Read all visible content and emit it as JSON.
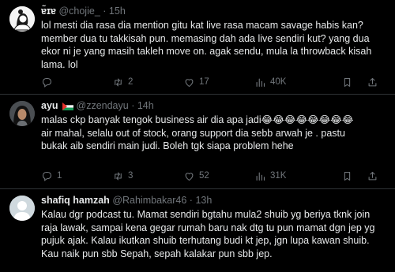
{
  "tweets": [
    {
      "name": "ɐ̃ɪɐ",
      "handle": "@chojie_",
      "dot": "·",
      "time": "15h",
      "text": "lol mesti dia rasa dia mention gitu kat live rasa macam savage habis kan?\nmember dua tu takkisah pun. memasing dah ada live sendiri kut? yang dua\nekor ni je yang masih takleh move on. agak sendu, mula la throwback kisah\nlama. lol",
      "replies": "",
      "reposts": "2",
      "likes": "17",
      "views": "40K"
    },
    {
      "name": "ayu",
      "handle": "@zzendayu",
      "dot": "·",
      "time": "14h",
      "text": "malas ckp banyak tengok business air dia apa jadi😂😂😂😂😂😂😂😂\nair mahal, selalu out of stock, orang support dia sebb arwah je . pastu\nbukak aib sendiri main judi. Boleh tgk siapa problem hehe",
      "replies": "1",
      "reposts": "3",
      "likes": "52",
      "views": "31K"
    },
    {
      "name": "shafiq hamzah",
      "handle": "@Rahimbakar46",
      "dot": "·",
      "time": "13h",
      "text": "Kalau dgr podcast tu. Mamat sendiri bgtahu mula2 shuib yg beriya tknk join\nraja lawak, sampai kena gegar rumah baru nak dtg tu pun mamat dgn jep yg\npujuk ajak. Kalau ikutkan shuib terhutang budi kt jep, jgn lupa kawan shuib.\nKau naik pun sbb Sepah, sepah kalakar pun sbb jep."
    }
  ],
  "icons": {
    "reply": "reply-icon",
    "repost": "repost-icon",
    "like": "like-icon",
    "views": "views-icon",
    "bookmark": "bookmark-icon",
    "share": "share-icon"
  },
  "colors": {
    "background": "#000000",
    "text": "#e7e9ea",
    "muted": "#71767b",
    "divider": "#2f3336"
  }
}
